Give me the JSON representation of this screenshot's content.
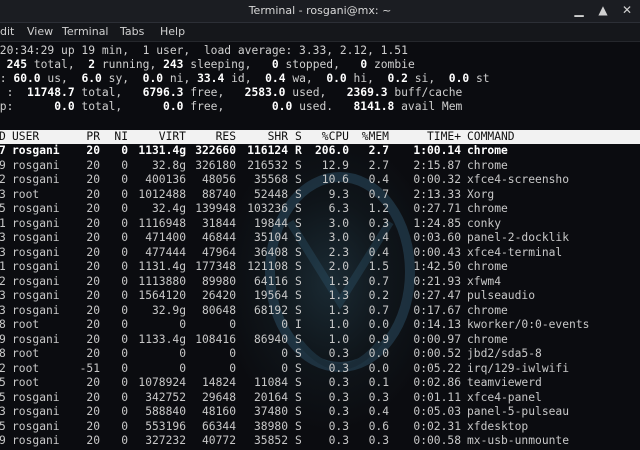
{
  "window": {
    "title": "Terminal - rosgani@mx: ~",
    "buttons": {
      "minimize": "▁",
      "maximize": "▲",
      "close": "✕"
    }
  },
  "menu": [
    "dit",
    "View",
    "Terminal",
    "Tabs",
    "Help"
  ],
  "summary": {
    "l1": " 20:34:29 up 19 min,  1 user,  load average: 3.33, 2.12, 1.51",
    "l2": {
      "pre": ": ",
      "v1": "245",
      "t1": " total,  ",
      "v2": "2",
      "t2": " running, ",
      "v3": "243",
      "t3": " sleeping,   ",
      "v4": "0",
      "t4": " stopped,   ",
      "v5": "0",
      "t5": " zombie"
    },
    "l3": {
      "pre": "): ",
      "v1": "60.0",
      "t1": " us,  ",
      "v2": "6.0",
      "t2": " sy,  ",
      "v3": "0.0",
      "t3": " ni, ",
      "v4": "33.4",
      "t4": " id,  ",
      "v5": "0.4",
      "t5": " wa,  ",
      "v6": "0.0",
      "t6": " hi,  ",
      "v7": "0.2",
      "t7": " si,  ",
      "v8": "0.0",
      "t8": " st"
    },
    "l4": {
      "pre": "m :  ",
      "v1": "11748.7",
      "t1": " total,   ",
      "v2": "6796.3",
      "t2": " free,   ",
      "v3": "2583.0",
      "t3": " used,   ",
      "v4": "2369.3",
      "t4": " buff/cache"
    },
    "l5": {
      "pre": "ap:      ",
      "v1": "0.0",
      "t1": " total,      ",
      "v2": "0.0",
      "t2": " free,       ",
      "v3": "0.0",
      "t3": " used.   ",
      "v4": "8141.8",
      "t4": " avail Mem"
    }
  },
  "columns": [
    "D",
    "USER",
    "PR",
    "NI",
    "VIRT",
    "RES",
    "SHR",
    "S",
    "%CPU",
    "%MEM",
    "TIME+",
    "COMMAND"
  ],
  "processes": [
    [
      "7",
      "rosgani",
      "20",
      "0",
      "1131.4g",
      "322660",
      "116124",
      "R",
      "206.0",
      "2.7",
      "1:00.14",
      "chrome"
    ],
    [
      "9",
      "rosgani",
      "20",
      "0",
      "32.8g",
      "326180",
      "216532",
      "S",
      "12.9",
      "2.7",
      "2:15.87",
      "chrome"
    ],
    [
      "2",
      "rosgani",
      "20",
      "0",
      "400136",
      "48056",
      "35568",
      "S",
      "10.6",
      "0.4",
      "0:00.32",
      "xfce4-screensho"
    ],
    [
      "3",
      "root",
      "20",
      "0",
      "1012488",
      "88740",
      "52448",
      "S",
      "9.3",
      "0.7",
      "2:13.33",
      "Xorg"
    ],
    [
      "5",
      "rosgani",
      "20",
      "0",
      "32.4g",
      "139948",
      "103236",
      "S",
      "6.3",
      "1.2",
      "0:27.71",
      "chrome"
    ],
    [
      "1",
      "rosgani",
      "20",
      "0",
      "1116948",
      "31844",
      "19844",
      "S",
      "3.0",
      "0.3",
      "1:24.85",
      "conky"
    ],
    [
      "3",
      "rosgani",
      "20",
      "0",
      "471400",
      "46844",
      "35104",
      "S",
      "3.0",
      "0.4",
      "0:03.60",
      "panel-2-docklik"
    ],
    [
      "3",
      "rosgani",
      "20",
      "0",
      "477444",
      "47964",
      "36408",
      "S",
      "2.3",
      "0.4",
      "0:00.43",
      "xfce4-terminal"
    ],
    [
      "1",
      "rosgani",
      "20",
      "0",
      "1131.4g",
      "177348",
      "121108",
      "S",
      "2.0",
      "1.5",
      "1:42.50",
      "chrome"
    ],
    [
      "2",
      "rosgani",
      "20",
      "0",
      "1113880",
      "89980",
      "64116",
      "S",
      "1.3",
      "0.7",
      "0:21.93",
      "xfwm4"
    ],
    [
      "3",
      "rosgani",
      "20",
      "0",
      "1564120",
      "26420",
      "19564",
      "S",
      "1.3",
      "0.2",
      "0:27.47",
      "pulseaudio"
    ],
    [
      "3",
      "rosgani",
      "20",
      "0",
      "32.9g",
      "80648",
      "68192",
      "S",
      "1.3",
      "0.7",
      "0:17.67",
      "chrome"
    ],
    [
      "8",
      "root",
      "20",
      "0",
      "0",
      "0",
      "0",
      "I",
      "1.0",
      "0.0",
      "0:14.13",
      "kworker/0:0-events"
    ],
    [
      "9",
      "rosgani",
      "20",
      "0",
      "1133.4g",
      "108416",
      "86940",
      "S",
      "1.0",
      "0.9",
      "0:00.97",
      "chrome"
    ],
    [
      "8",
      "root",
      "20",
      "0",
      "0",
      "0",
      "0",
      "S",
      "0.3",
      "0.0",
      "0:00.52",
      "jbd2/sda5-8"
    ],
    [
      "2",
      "root",
      "-51",
      "0",
      "0",
      "0",
      "0",
      "S",
      "0.3",
      "0.0",
      "0:05.22",
      "irq/129-iwlwifi"
    ],
    [
      "5",
      "root",
      "20",
      "0",
      "1078924",
      "14824",
      "11084",
      "S",
      "0.3",
      "0.1",
      "0:02.86",
      "teamviewerd"
    ],
    [
      "5",
      "rosgani",
      "20",
      "0",
      "342752",
      "29648",
      "20164",
      "S",
      "0.3",
      "0.3",
      "0:01.11",
      "xfce4-panel"
    ],
    [
      "3",
      "rosgani",
      "20",
      "0",
      "588840",
      "48160",
      "37480",
      "S",
      "0.3",
      "0.4",
      "0:05.03",
      "panel-5-pulseau"
    ],
    [
      "5",
      "rosgani",
      "20",
      "0",
      "553196",
      "66344",
      "38980",
      "S",
      "0.3",
      "0.6",
      "0:02.31",
      "xfdesktop"
    ],
    [
      "9",
      "rosgani",
      "20",
      "0",
      "327232",
      "40772",
      "35852",
      "S",
      "0.3",
      "0.3",
      "0:00.58",
      "mx-usb-unmounte"
    ]
  ]
}
